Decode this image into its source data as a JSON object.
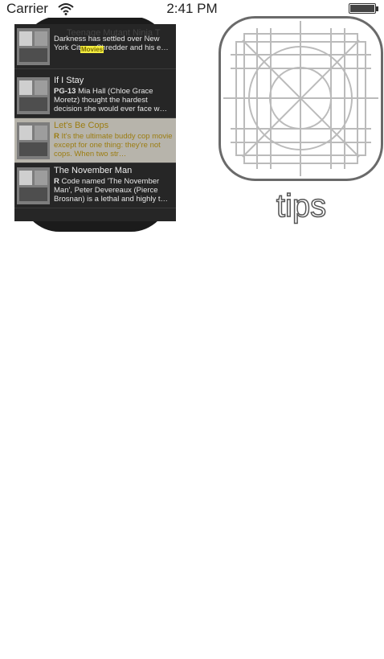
{
  "status_bar": {
    "carrier": "Carrier",
    "time": "2:41 PM"
  },
  "app_preview": {
    "nav": {
      "title": "Teenage Mutant Ninja T",
      "label": "Movies"
    },
    "movies": [
      {
        "title": "",
        "rating": "",
        "description": "Darkness has settled over New York City as Shredder and his e…"
      },
      {
        "title": "If I Stay",
        "rating": "PG-13",
        "description": "Mia Hall (Chloe Grace Moretz) thought the hardest decision she would ever face w…"
      },
      {
        "title": "Let's Be Cops",
        "rating": "R",
        "description": "It's the ultimate buddy cop movie except for one thing: they're not cops. When two str…",
        "selected": true
      },
      {
        "title": "The November Man",
        "rating": "R",
        "description": "Code named 'The November Man', Peter Devereaux (Pierce Brosnan) is a lethal and highly t…"
      }
    ]
  },
  "tips": {
    "label": "tips"
  }
}
